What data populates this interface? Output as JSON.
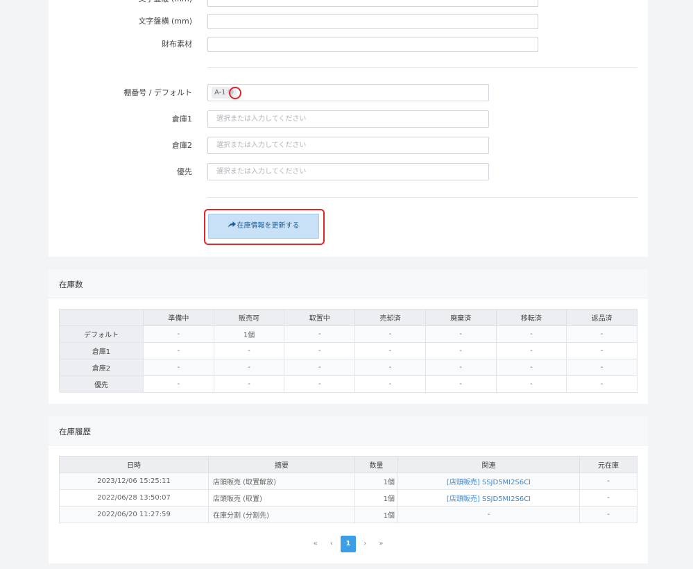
{
  "form": {
    "fields_top": [
      {
        "label": "文字盤縦 (mm)",
        "value": ""
      },
      {
        "label": "文字盤横 (mm)",
        "value": ""
      },
      {
        "label": "財布素材",
        "value": ""
      }
    ],
    "shelf_default": {
      "label": "棚番号 / デフォルト",
      "tag": "A-1"
    },
    "shelf_fields": [
      {
        "label": "倉庫1",
        "placeholder": "選択または入力してください"
      },
      {
        "label": "倉庫2",
        "placeholder": "選択または入力してください"
      },
      {
        "label": "優先",
        "placeholder": "選択または入力してください"
      }
    ],
    "submit": {
      "icon": "share-arrow-icon",
      "label": "在庫情報を更新する"
    }
  },
  "stock": {
    "title": "在庫数",
    "columns": [
      "",
      "準備中",
      "販売可",
      "取置中",
      "売却済",
      "廃棄済",
      "移転済",
      "返品済"
    ],
    "rows": [
      {
        "name": "デフォルト",
        "cells": [
          "-",
          "1個",
          "-",
          "-",
          "-",
          "-",
          "-"
        ]
      },
      {
        "name": "倉庫1",
        "cells": [
          "-",
          "-",
          "-",
          "-",
          "-",
          "-",
          "-"
        ]
      },
      {
        "name": "倉庫2",
        "cells": [
          "-",
          "-",
          "-",
          "-",
          "-",
          "-",
          "-"
        ]
      },
      {
        "name": "優先",
        "cells": [
          "-",
          "-",
          "-",
          "-",
          "-",
          "-",
          "-"
        ]
      }
    ]
  },
  "history": {
    "title": "在庫履歴",
    "columns": [
      "日時",
      "摘要",
      "数量",
      "関連",
      "元在庫"
    ],
    "rows": [
      {
        "datetime": "2023/12/06 15:25:11",
        "summary": "店頭販売 (取置解放)",
        "qty": "1個",
        "related": "[店頭販売] SSJD5MI2S6CI",
        "origin": "-"
      },
      {
        "datetime": "2022/06/28 13:50:07",
        "summary": "店頭販売 (取置)",
        "qty": "1個",
        "related": "[店頭販売] SSJD5MI2S6CI",
        "origin": "-"
      },
      {
        "datetime": "2022/06/20 11:27:59",
        "summary": "在庫分割 (分割先)",
        "qty": "1個",
        "related": "-",
        "origin": "-"
      }
    ],
    "pager": {
      "first": "«",
      "prev": "‹",
      "current": "1",
      "next": "›",
      "last": "»"
    }
  },
  "colors": {
    "accent": "#3c9ee6",
    "highlight": "#e0252b",
    "link": "#3c89d0"
  }
}
